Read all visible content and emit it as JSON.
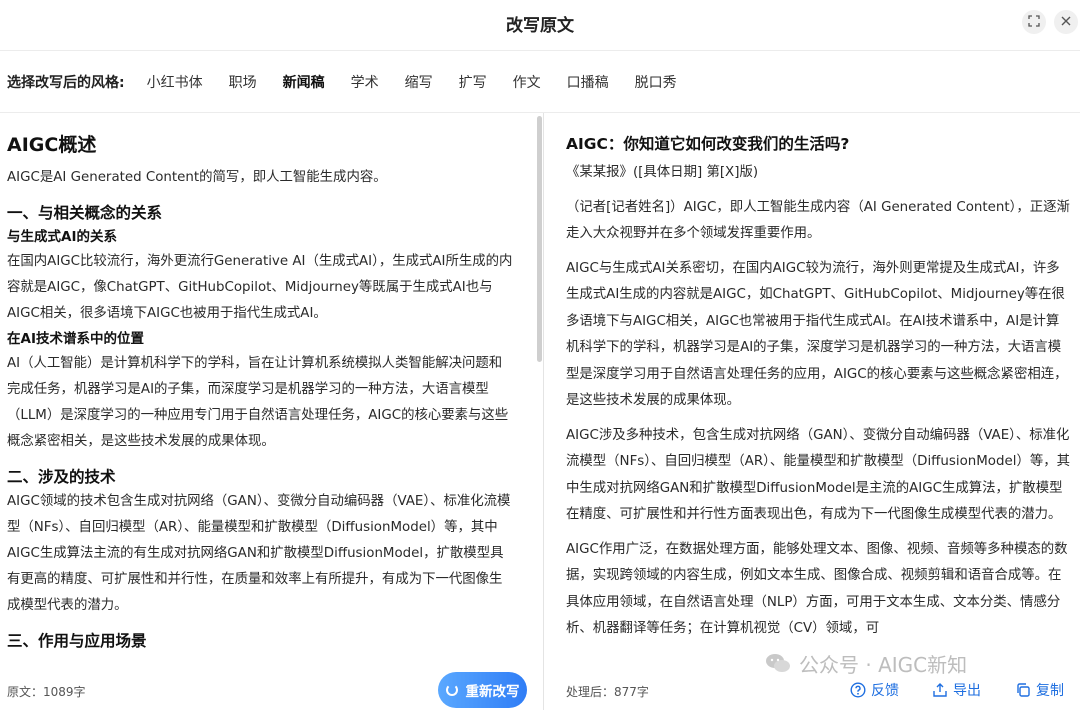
{
  "header": {
    "title": "改写原文"
  },
  "stylebar": {
    "label": "选择改写后的风格:",
    "options": [
      "小红书体",
      "职场",
      "新闻稿",
      "学术",
      "缩写",
      "扩写",
      "作文",
      "口播稿",
      "脱口秀"
    ],
    "active": "新闻稿"
  },
  "left": {
    "title": "AIGC概述",
    "intro": "AIGC是AI Generated Content的简写，即人工智能生成内容。",
    "h2_1": "一、与相关概念的关系",
    "h3_1": "与生成式AI的关系",
    "p1": "在国内AIGC比较流行，海外更流行Generative AI（生成式AI），生成式AI所生成的内容就是AIGC，像ChatGPT、GitHubCopilot、Midjourney等既属于生成式AI也与AIGC相关，很多语境下AIGC也被用于指代生成式AI。",
    "h3_2": "在AI技术谱系中的位置",
    "p2": "AI（人工智能）是计算机科学下的学科，旨在让计算机系统模拟人类智能解决问题和完成任务，机器学习是AI的子集，而深度学习是机器学习的一种方法，大语言模型（LLM）是深度学习的一种应用专门用于自然语言处理任务，AIGC的核心要素与这些概念紧密相关，是这些技术发展的成果体现。",
    "h2_2": "二、涉及的技术",
    "p3": "AIGC领域的技术包含生成对抗网络（GAN）、变微分自动编码器（VAE）、标准化流模型（NFs）、自回归模型（AR）、能量模型和扩散模型（DiffusionModel）等，其中AIGC生成算法主流的有生成对抗网络GAN和扩散模型DiffusionModel，扩散模型具有更高的精度、可扩展性和并行性，在质量和效率上有所提升，有成为下一代图像生成模型代表的潜力。",
    "h2_3": "三、作用与应用场景"
  },
  "right": {
    "title": "AIGC：你知道它如何改变我们的生活吗?",
    "byline": "《某某报》([具体日期] 第[X]版)",
    "p1": "（记者[记者姓名]）AIGC，即人工智能生成内容（AI Generated Content），正逐渐走入大众视野并在多个领域发挥重要作用。",
    "p2": "AIGC与生成式AI关系密切，在国内AIGC较为流行，海外则更常提及生成式AI，许多生成式AI生成的内容就是AIGC，如ChatGPT、GitHubCopilot、Midjourney等在很多语境下与AIGC相关，AIGC也常被用于指代生成式AI。在AI技术谱系中，AI是计算机科学下的学科，机器学习是AI的子集，深度学习是机器学习的一种方法，大语言模型是深度学习用于自然语言处理任务的应用，AIGC的核心要素与这些概念紧密相连，是这些技术发展的成果体现。",
    "p3": "AIGC涉及多种技术，包含生成对抗网络（GAN）、变微分自动编码器（VAE）、标准化流模型（NFs）、自回归模型（AR）、能量模型和扩散模型（DiffusionModel）等，其中生成对抗网络GAN和扩散模型DiffusionModel是主流的AIGC生成算法，扩散模型在精度、可扩展性和并行性方面表现出色，有成为下一代图像生成模型代表的潜力。",
    "p4": "AIGC作用广泛，在数据处理方面，能够处理文本、图像、视频、音频等多种模态的数据，实现跨领域的内容生成，例如文本生成、图像合成、视频剪辑和语音合成等。在具体应用领域，在自然语言处理（NLP）方面，可用于文本生成、文本分类、情感分析、机器翻译等任务；在计算机视觉（CV）领域，可"
  },
  "footer": {
    "left_count": "原文：1089字",
    "rewrite_label": "重新改写",
    "right_count": "处理后：877字",
    "feedback": "反馈",
    "export": "导出",
    "copy": "复制"
  },
  "watermark": "公众号 · AIGC新知",
  "colors": {
    "accent": "#1f6fe0",
    "button": "#2f7df6"
  },
  "icons": {
    "expand": "expand-icon",
    "close": "close-icon",
    "feedback": "question-circle-icon",
    "export": "export-icon",
    "copy": "copy-icon",
    "spinner": "spinner-icon",
    "watermark_logo": "wechat-icon"
  }
}
